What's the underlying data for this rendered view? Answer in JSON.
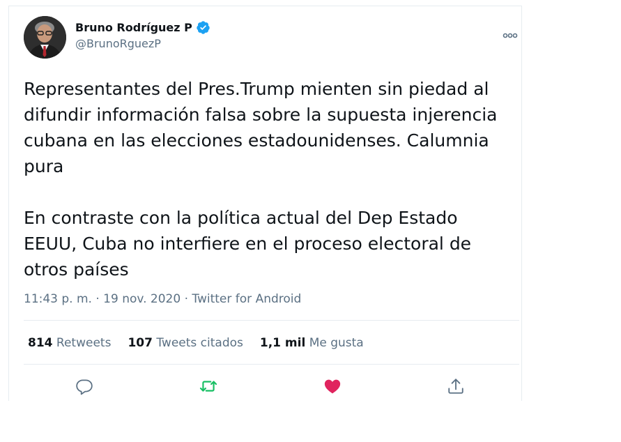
{
  "author": {
    "name": "Bruno Rodríguez P",
    "handle": "@BrunoRguezP",
    "verified": true
  },
  "tweet": {
    "paragraphs": [
      "Representantes del Pres.Trump mienten sin piedad al\ndifundir información falsa sobre la supuesta injerencia\ncubana en las elecciones estadounidenses. Calumnia\npura",
      "En contraste con la política actual del Dep Estado\nEEUU, Cuba no interfiere en el proceso electoral de\notros países"
    ],
    "meta": "11:43 p. m. · 19 nov. 2020 · Twitter for Android"
  },
  "stats": {
    "retweets_count": "814",
    "retweets_label": "Retweets",
    "quotes_count": "107",
    "quotes_label": "Tweets citados",
    "likes_count": "1,1 mil",
    "likes_label": "Me gusta"
  },
  "actions": {
    "reply_icon": "reply-icon",
    "retweet_icon": "retweet-icon",
    "like_icon": "heart-icon",
    "share_icon": "share-icon"
  },
  "colors": {
    "verified": "#1da1f2",
    "retweet_active": "#17bf63",
    "like_active": "#e0245e",
    "muted": "#5b7083",
    "text": "#0f1419",
    "border": "#e6ecf0"
  }
}
